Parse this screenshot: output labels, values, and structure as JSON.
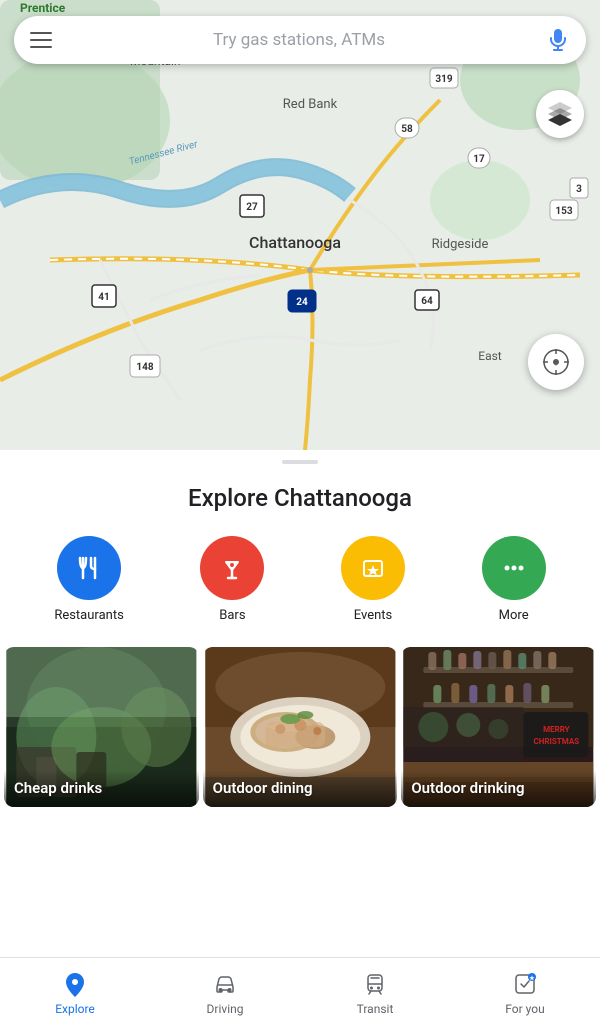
{
  "search": {
    "placeholder": "Try gas stations, ATMs"
  },
  "map": {
    "city": "Chattanooga",
    "labels": [
      "Red Bank",
      "Ridgeside",
      "East",
      "Mountain"
    ],
    "river": "Tennessee River",
    "routes": [
      "319",
      "58",
      "17",
      "153",
      "27",
      "41",
      "148",
      "24",
      "64",
      "3"
    ]
  },
  "explore": {
    "title": "Explore Chattanooga",
    "categories": [
      {
        "id": "restaurants",
        "label": "Restaurants",
        "color": "#1a73e8",
        "icon": "🍴"
      },
      {
        "id": "bars",
        "label": "Bars",
        "color": "#ea4335",
        "icon": "🍸"
      },
      {
        "id": "events",
        "label": "Events",
        "color": "#fbbc04",
        "icon": "⭐"
      },
      {
        "id": "more",
        "label": "More",
        "color": "#34a853",
        "icon": "•••"
      }
    ],
    "cards": [
      {
        "id": "cheap-drinks",
        "label": "Cheap drinks"
      },
      {
        "id": "outdoor-dining",
        "label": "Outdoor dining"
      },
      {
        "id": "outdoor-drinking",
        "label": "Outdoor drinking"
      }
    ]
  },
  "nav": {
    "items": [
      {
        "id": "explore",
        "label": "Explore",
        "active": true
      },
      {
        "id": "driving",
        "label": "Driving",
        "active": false
      },
      {
        "id": "transit",
        "label": "Transit",
        "active": false
      },
      {
        "id": "foryou",
        "label": "For you",
        "active": false
      }
    ]
  }
}
